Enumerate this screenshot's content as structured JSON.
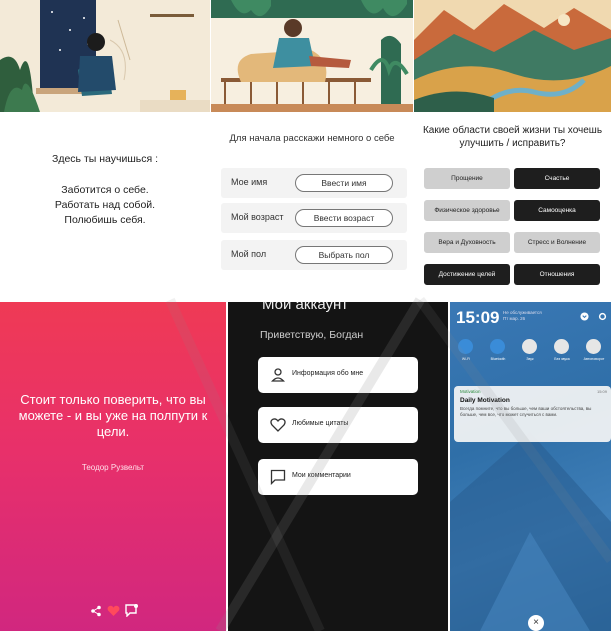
{
  "panel1": {
    "heading": "Здесь ты научишься :",
    "lines": [
      "Заботится о себе.",
      "Работать над собой.",
      "Полюбишь себя."
    ]
  },
  "panel2": {
    "intro": "Для начала расскажи немного о себе",
    "fields": [
      {
        "label": "Мое имя",
        "button": "Ввести имя"
      },
      {
        "label": "Мой возраст",
        "button": "Ввести возраст"
      },
      {
        "label": "Мой пол",
        "button": "Выбрать пол"
      }
    ]
  },
  "panel3": {
    "question": "Какие области своей жизни ты хочешь улучшить / исправить?",
    "options": [
      {
        "label": "Прощение",
        "selected": false
      },
      {
        "label": "Счастье",
        "selected": true
      },
      {
        "label": "Физическое здоровье",
        "selected": false
      },
      {
        "label": "Самооценка",
        "selected": true
      },
      {
        "label": "Вера и Духовность",
        "selected": false
      },
      {
        "label": "Стресс и Волнение",
        "selected": false
      },
      {
        "label": "Достижение целей",
        "selected": true
      },
      {
        "label": "Отношения",
        "selected": true
      }
    ]
  },
  "panel4": {
    "quote": "Стоит только поверить, что вы можете - и вы уже на полпути к цели.",
    "author": "Теодор Рузвельт",
    "icons": [
      "share-icon",
      "heart-icon",
      "comment-icon"
    ]
  },
  "panel5": {
    "title": "Мой аккаунт",
    "greeting": "Приветствую, Богдан",
    "cards": [
      {
        "label": "Информация обо мне",
        "icon": "person-icon"
      },
      {
        "label": "Любимые цитаты",
        "icon": "heart-icon"
      },
      {
        "label": "Мои комментарии",
        "icon": "comment-icon"
      }
    ]
  },
  "panel6": {
    "time": "15:09",
    "date_line": "Не обслуживается",
    "date_line2": "Пт мар. 26",
    "quick_settings": [
      "Wi-Fi",
      "Bluetooth",
      "Звук",
      "Без звука",
      "Автоповорот"
    ],
    "notification": {
      "app": "Motivation",
      "title": "Daily Motivation",
      "body": "Всегда помните, что вы больше, чем ваши обстоятельства, вы больше, чем все, что может случиться с вами.",
      "time": "15:09"
    },
    "close_symbol": "×"
  }
}
